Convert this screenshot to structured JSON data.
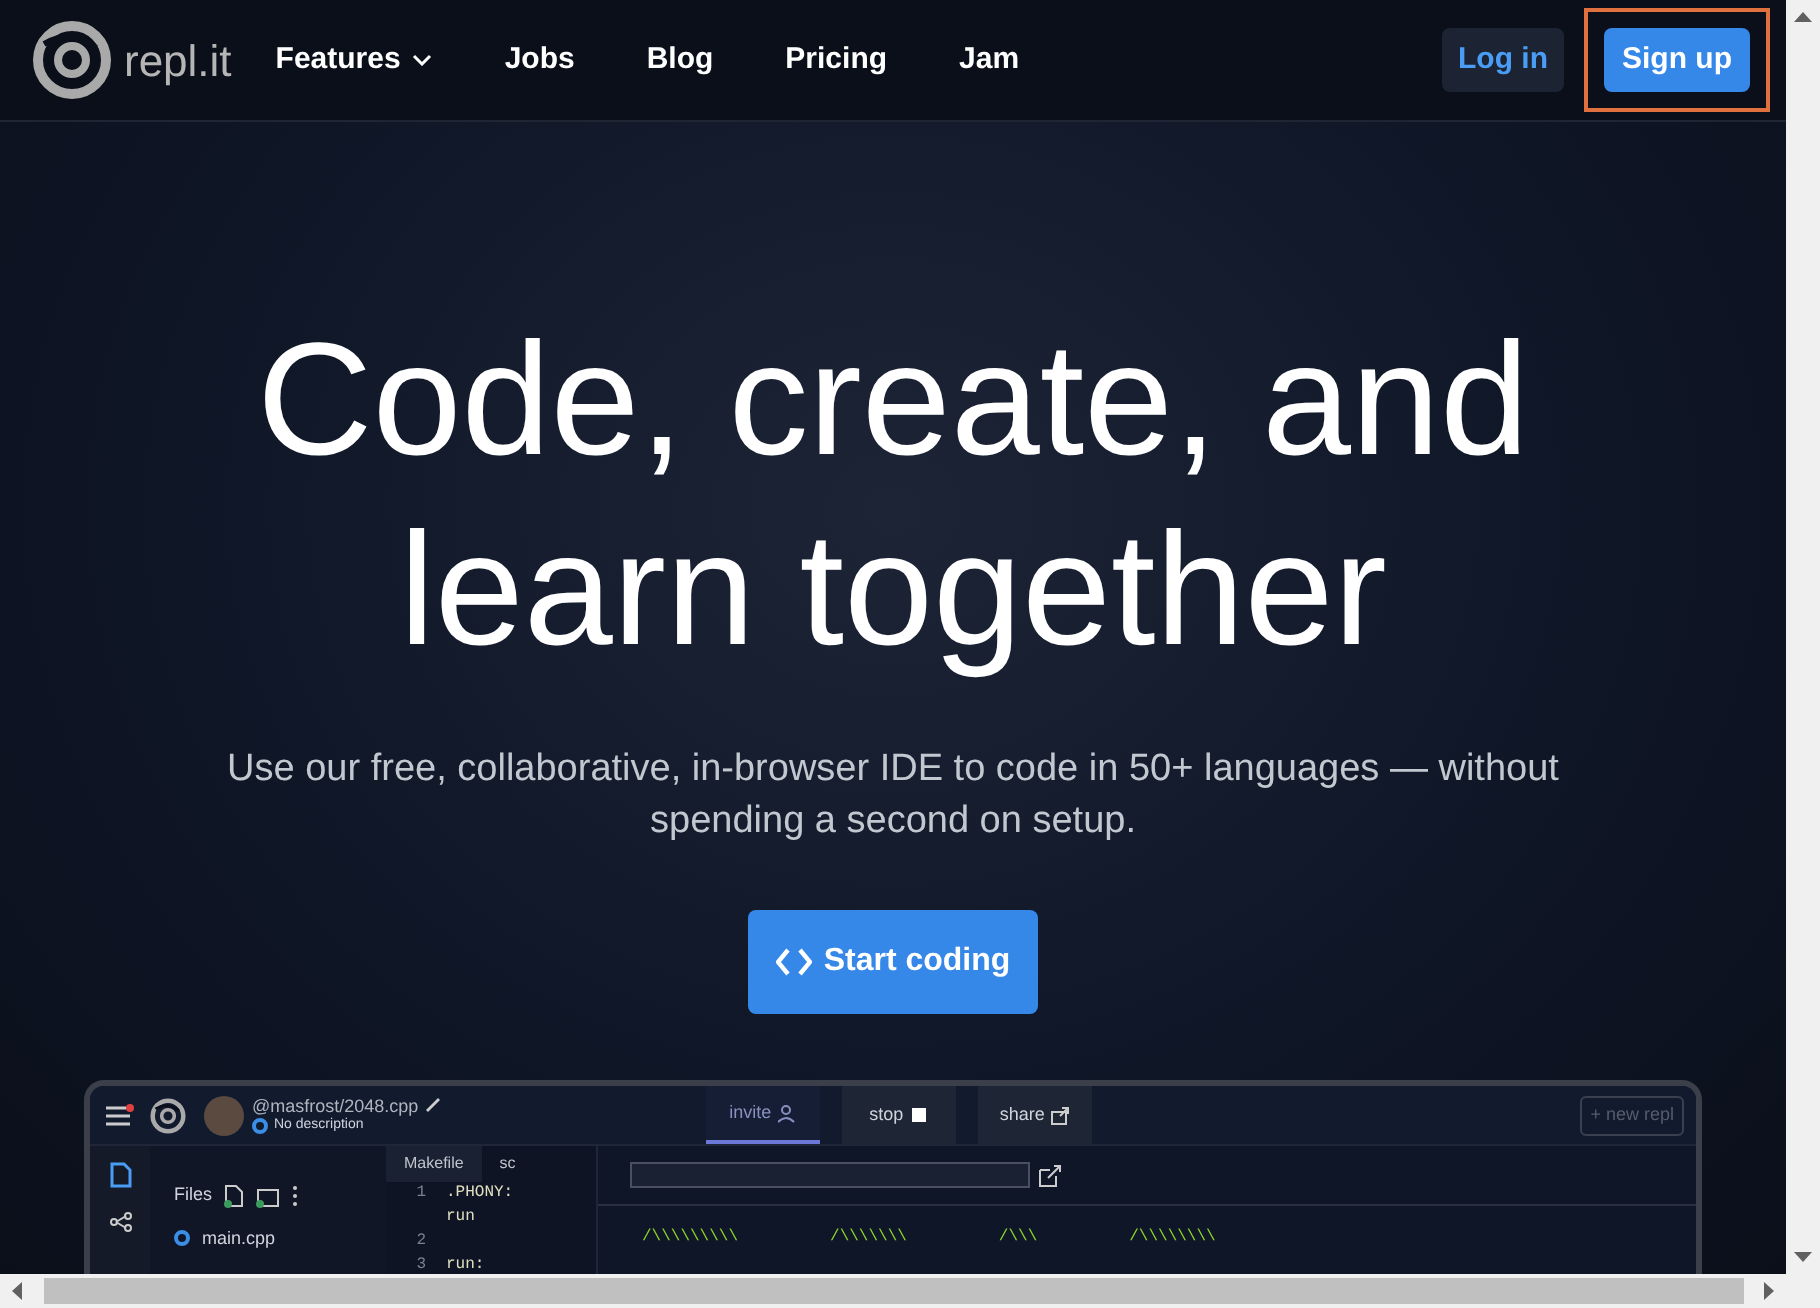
{
  "nav": {
    "logo_text": "repl.it",
    "links": [
      {
        "label": "Features",
        "kind": "dropdown"
      },
      {
        "label": "Jobs",
        "kind": "link"
      },
      {
        "label": "Blog",
        "kind": "link"
      },
      {
        "label": "Pricing",
        "kind": "link"
      },
      {
        "label": "Jam",
        "kind": "link"
      }
    ],
    "login": "Log in",
    "signup": "Sign up",
    "signup_highlighted": true
  },
  "hero": {
    "title_lines": [
      "Code, create, and",
      "learn together"
    ],
    "subtitle": "Use our free, collaborative, in-browser IDE to code in 50+ languages — without spending a second on setup.",
    "cta": "Start coding"
  },
  "ide": {
    "repl_name": "@masfrost/2048.cpp",
    "description": "No description",
    "tabs": [
      {
        "label": "invite",
        "selected": true
      },
      {
        "label": "stop",
        "selected": false
      },
      {
        "label": "share",
        "selected": false
      }
    ],
    "new_repl": "+ new repl",
    "files_title": "Files",
    "files": [
      "main.cpp"
    ],
    "editor_tabs": [
      "Makefile",
      "sc"
    ],
    "code": [
      {
        "num": "1",
        "text": ".PHONY:"
      },
      {
        "text": "run"
      },
      {
        "num": "2"
      },
      {
        "num": "3",
        "text": "run:"
      }
    ],
    "console_marks": [
      "/\\\\\\\\\\\\\\\\\\",
      "/\\\\\\\\\\\\\\",
      "/\\\\\\",
      "/\\\\\\\\\\\\\\\\"
    ]
  }
}
